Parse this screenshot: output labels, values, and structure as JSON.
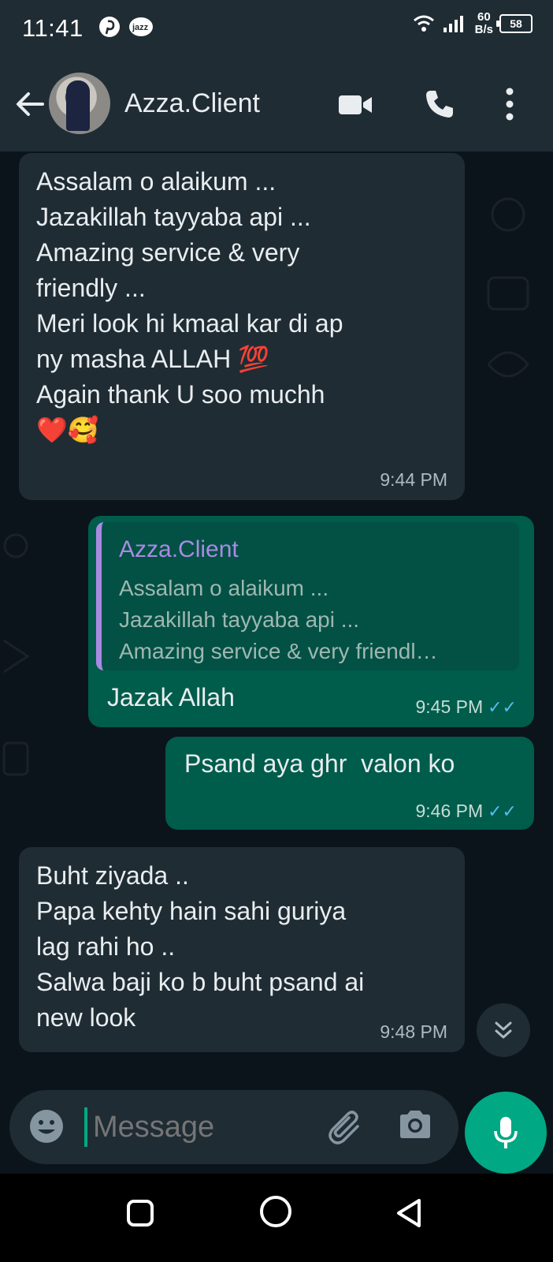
{
  "status_bar": {
    "time": "11:41",
    "net_speed_value": "60",
    "net_speed_unit": "B/s",
    "battery": "58"
  },
  "header": {
    "contact_name": "Azza.Client"
  },
  "messages": [
    {
      "direction": "incoming",
      "text": "Assalam o alaikum ...\nJazakillah tayyaba api ...\nAmazing service & very\nfriendly ...\nMeri look hi kmaal kar di ap\nny masha ALLAH 💯\nAgain thank U soo muchh\n❤️🥰",
      "time": "9:44 PM"
    },
    {
      "direction": "outgoing",
      "quoted_author": "Azza.Client",
      "quoted_text": "Assalam o alaikum ...\nJazakillah tayyaba api ...\nAmazing service & very friendl…",
      "text": "Jazak Allah",
      "time": "9:45 PM",
      "status": "read"
    },
    {
      "direction": "outgoing",
      "text": "Psand aya ghr  valon ko",
      "time": "9:46 PM",
      "status": "read"
    },
    {
      "direction": "incoming",
      "text": "Buht ziyada ..\nPapa kehty hain sahi guriya\nlag rahi ho ..\nSalwa baji ko b buht psand ai\nnew look",
      "time": "9:48 PM"
    }
  ],
  "composer": {
    "placeholder": "Message"
  },
  "colors": {
    "background": "#0b141a",
    "bar": "#1f2c34",
    "incoming_bubble": "#1f2c34",
    "outgoing_bubble": "#005c4b",
    "accent": "#00a884",
    "read_ticks": "#53bdeb",
    "quote_author": "#a98ae3"
  },
  "icons": {
    "status_left": [
      "pinterest-icon",
      "jazz-icon"
    ],
    "status_right": [
      "wifi-icon",
      "signal-icon",
      "battery-icon"
    ],
    "header": [
      "back-arrow-icon",
      "video-call-icon",
      "voice-call-icon",
      "more-options-icon"
    ],
    "composer": [
      "emoji-icon",
      "attach-icon",
      "camera-icon",
      "mic-icon"
    ],
    "nav": [
      "recents-icon",
      "home-icon",
      "back-icon"
    ]
  }
}
